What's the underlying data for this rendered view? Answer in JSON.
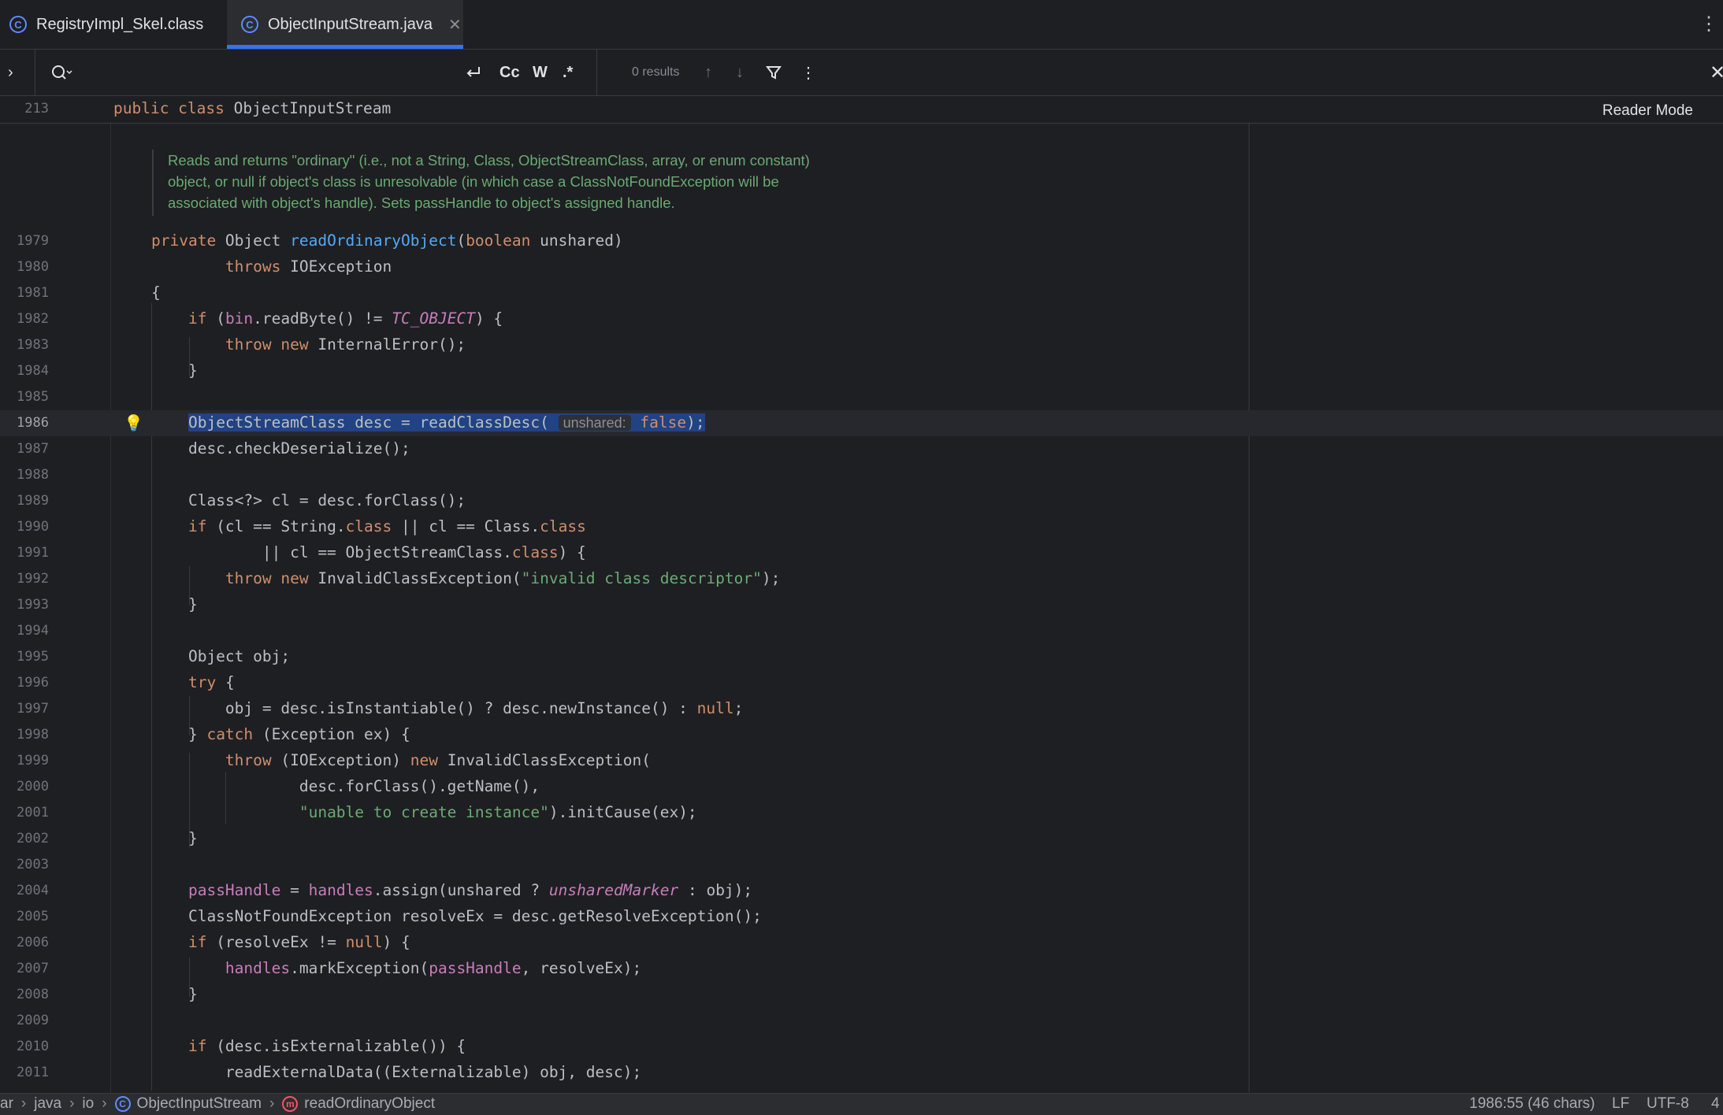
{
  "tabs": [
    {
      "label": "RegistryImpl_Skel.class",
      "active": false
    },
    {
      "label": "ObjectInputStream.java",
      "active": true
    }
  ],
  "find": {
    "results": "0 results",
    "options": [
      "Cc",
      "W",
      ".*"
    ]
  },
  "sticky": {
    "line": "213",
    "code_kw": "public class",
    "code_name": "ObjectInputStream"
  },
  "reader_mode": "Reader Mode",
  "doc": {
    "lines": [
      "Reads and returns \"ordinary\" (i.e., not a String, Class, ObjectStreamClass, array, or enum constant)",
      "object, or null if object's class is unresolvable (in which case a ClassNotFoundException will be",
      "associated with object's handle). Sets passHandle to object's assigned handle."
    ]
  },
  "hint": "unshared:",
  "line_numbers": [
    "1979",
    "1980",
    "1981",
    "1982",
    "1983",
    "1984",
    "1985",
    "1986",
    "1987",
    "1988",
    "1989",
    "1990",
    "1991",
    "1992",
    "1993",
    "1994",
    "1995",
    "1996",
    "1997",
    "1998",
    "1999",
    "2000",
    "2001",
    "2002",
    "2003",
    "2004",
    "2005",
    "2006",
    "2007",
    "2008",
    "2009",
    "2010",
    "2011"
  ],
  "status": {
    "breadcrumb": [
      "ar",
      "java",
      "io",
      "ObjectInputStream",
      "readOrdinaryObject"
    ],
    "position": "1986:55 (46 chars)",
    "line_sep": "LF",
    "encoding": "UTF-8",
    "indent": "4"
  }
}
